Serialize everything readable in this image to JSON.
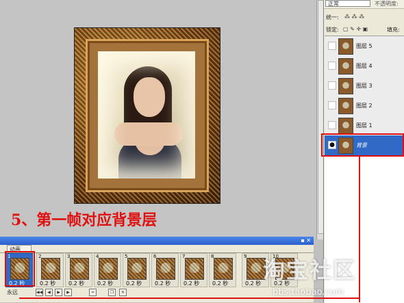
{
  "instruction": "5、第一帧对应背景层",
  "layers_panel": {
    "blend_mode": "正常",
    "opacity_label": "不透明度:",
    "unify_label": "统一:",
    "lock_label": "锁定:",
    "fill_label": "填充:",
    "layers": [
      {
        "name": "图层 5",
        "active": false
      },
      {
        "name": "图层 4",
        "active": false
      },
      {
        "name": "图层 3",
        "active": false
      },
      {
        "name": "图层 2",
        "active": false
      },
      {
        "name": "图层 1",
        "active": false
      },
      {
        "name": "背景",
        "active": true
      }
    ]
  },
  "animation": {
    "tab_label": "动画",
    "loop_label": "永远",
    "frames": [
      {
        "num": "1",
        "delay": "0.2 秒"
      },
      {
        "num": "2",
        "delay": "0.2 秒"
      },
      {
        "num": "3",
        "delay": "0.2 秒"
      },
      {
        "num": "4",
        "delay": "0.2 秒"
      },
      {
        "num": "5",
        "delay": "0.2 秒"
      },
      {
        "num": "6",
        "delay": "0.2 秒"
      },
      {
        "num": "7",
        "delay": "0.2 秒"
      },
      {
        "num": "8",
        "delay": "0.2 秒"
      },
      {
        "num": "9",
        "delay": "0.2 秒"
      },
      {
        "num": "10",
        "delay": "0.2 秒"
      }
    ]
  },
  "watermark": {
    "brand": "淘宝社区",
    "url": "bbs.taobao.com"
  },
  "colors": {
    "highlight_red": "#e01010",
    "selection_blue": "#3169c6"
  }
}
